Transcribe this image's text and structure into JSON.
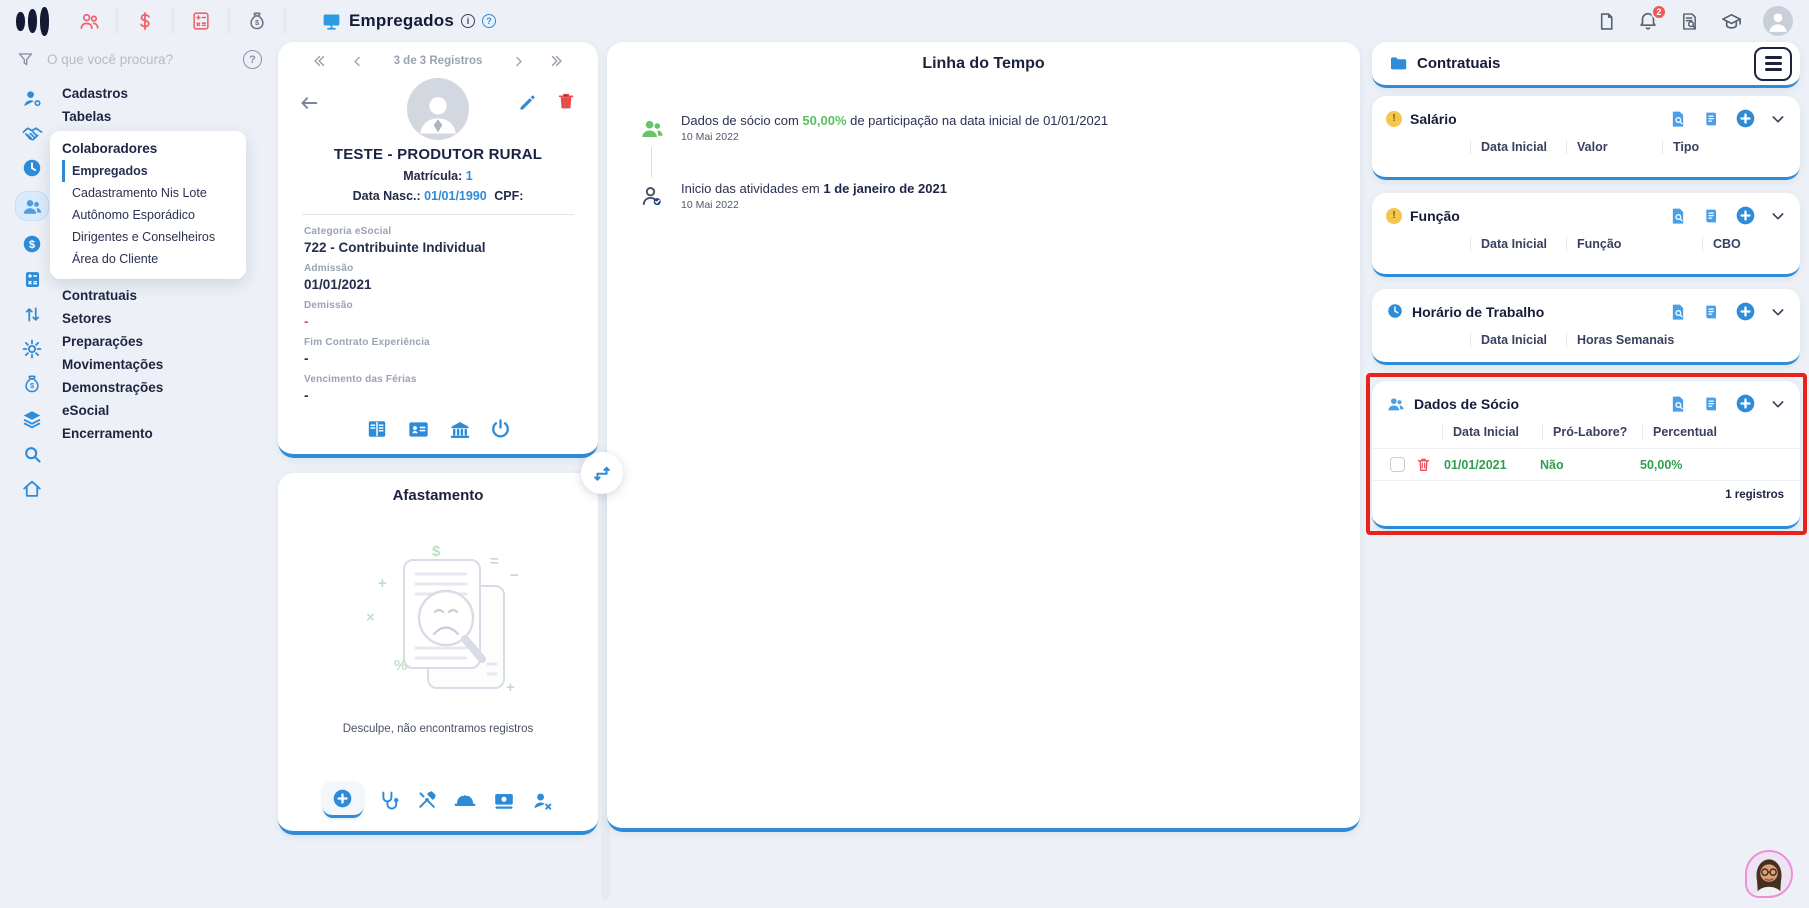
{
  "topbar": {
    "title": "Empregados",
    "info_glyph": "i",
    "help_glyph": "?",
    "notification_count": "2"
  },
  "sidebar": {
    "search_placeholder": "O que você procura?",
    "help_glyph": "?",
    "items": [
      "Cadastros",
      "Tabelas"
    ],
    "popup": {
      "title": "Colaboradores",
      "items": [
        "Empregados",
        "Cadastramento Nis Lote",
        "Autônomo Esporádico",
        "Dirigentes e Conselheiros",
        "Área do Cliente"
      ]
    },
    "items_after": [
      "Contratuais",
      "Setores",
      "Preparações",
      "Movimentações",
      "Demonstrações",
      "eSocial",
      "Encerramento"
    ]
  },
  "employee": {
    "pager_label": "3 de 3 Registros",
    "name": "TESTE - PRODUTOR RURAL",
    "matricula_label": "Matrícula:",
    "matricula_value": "1",
    "nasc_label": "Data Nasc.:",
    "nasc_value": "01/01/1990",
    "cpf_label": "CPF:",
    "fields": [
      {
        "label": "Categoria eSocial",
        "value": "722 - Contribuinte Individual"
      },
      {
        "label": "Admissão",
        "value": "01/01/2021"
      },
      {
        "label": "Demissão",
        "value": "-"
      },
      {
        "label": "Fim Contrato Experiência",
        "value": "-"
      },
      {
        "label": "Vencimento das Férias",
        "value": "-"
      }
    ]
  },
  "afastamento": {
    "title": "Afastamento",
    "empty_message": "Desculpe, não encontramos registros"
  },
  "timeline": {
    "title": "Linha do Tempo",
    "events": [
      {
        "text_pre": "Dados de sócio com ",
        "highlight": "50,00%",
        "text_post": " de participação na data inicial de 01/01/2021",
        "date": "10 Mai 2022"
      },
      {
        "text_pre": "Inicio das atividades em ",
        "bold": "1 de janeiro de 2021",
        "date": "10 Mai 2022"
      }
    ]
  },
  "contratuais": {
    "title": "Contratuais",
    "sections": [
      {
        "title": "Salário",
        "columns": [
          "Data Inicial",
          "Valor",
          "Tipo"
        ]
      },
      {
        "title": "Função",
        "columns": [
          "Data Inicial",
          "Função",
          "CBO"
        ]
      },
      {
        "title": "Horário de Trabalho",
        "columns": [
          "Data Inicial",
          "Horas Semanais"
        ]
      },
      {
        "title": "Dados de Sócio",
        "columns": [
          "Data Inicial",
          "Pró-Labore?",
          "Percentual"
        ],
        "row": {
          "data_inicial": "01/01/2021",
          "pro_labore": "Não",
          "percentual": "50,00%"
        },
        "footer": "1 registros"
      }
    ]
  },
  "colors": {
    "accent": "#2e8bd8",
    "coral": "#f4606c",
    "danger": "#e84b4b",
    "green": "#2f9e4f",
    "green_light": "#5cbf60",
    "navy": "#1c2240",
    "warning": "#f4c64d",
    "highlight_red": "#e8231b"
  }
}
